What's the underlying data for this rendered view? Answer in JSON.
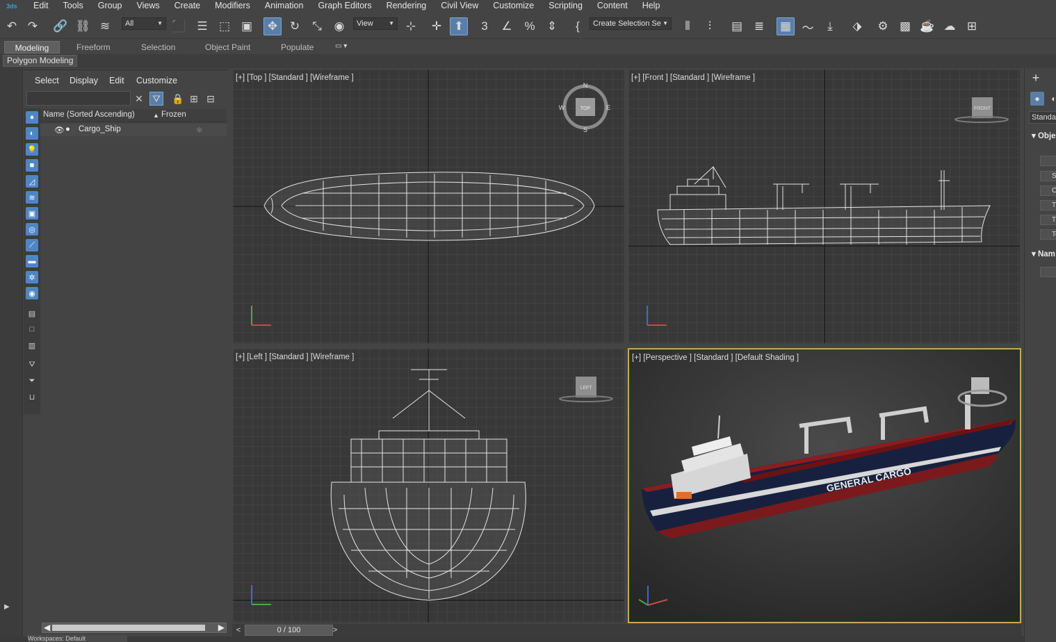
{
  "menu": {
    "logo": "3ds",
    "items": [
      "Edit",
      "Tools",
      "Group",
      "Views",
      "Create",
      "Modifiers",
      "Animation",
      "Graph Editors",
      "Rendering",
      "Civil View",
      "Customize",
      "Scripting",
      "Content",
      "Help"
    ]
  },
  "toolbar": {
    "filter_value": "All",
    "refcoord_value": "View",
    "selection_set_value": "Create Selection Se"
  },
  "ribbon": {
    "tabs": [
      "Modeling",
      "Freeform",
      "Selection",
      "Object Paint",
      "Populate"
    ],
    "active_tab": "Modeling",
    "subpanel": "Polygon Modeling"
  },
  "explorer": {
    "menu": [
      "Select",
      "Display",
      "Edit",
      "Customize"
    ],
    "search_value": "",
    "col_name": "Name (Sorted Ascending)",
    "col_frozen": "Frozen",
    "rows": [
      {
        "name": "Cargo_Ship"
      }
    ]
  },
  "viewports": {
    "top": {
      "label": "[+] [Top ] [Standard ] [Wireframe ]"
    },
    "front": {
      "label": "[+] [Front ] [Standard ] [Wireframe ]"
    },
    "left": {
      "label": "[+] [Left ] [Standard ] [Wireframe ]"
    },
    "perspective": {
      "label": "[+] [Perspective ] [Standard ] [Default Shading ]",
      "hull_text": "GENERAL CARGO"
    },
    "viewcube": {
      "top": "TOP",
      "front": "FRONT",
      "left": "LEFT",
      "n": "N",
      "s": "S",
      "e": "E",
      "w": "W"
    }
  },
  "timeline": {
    "frame_display": "0 / 100",
    "prev": "<",
    "next": ">"
  },
  "status": {
    "workspace": "Workspaces: Default"
  },
  "command_panel": {
    "create_tab": "+",
    "dropdown_value": "Standar",
    "rollout_object": "Obje",
    "rollout_name": "Nam",
    "buttons": [
      "",
      "S",
      "C",
      "T",
      "T",
      "Te"
    ]
  },
  "colors": {
    "accent_blue": "#5a7ea8",
    "active_viewport_border": "#c6a85a",
    "hull_red": "#8a1d1f",
    "hull_navy": "#17213f"
  }
}
